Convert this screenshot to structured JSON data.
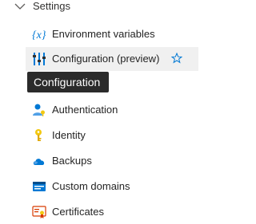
{
  "settings_group": {
    "label": "Settings",
    "items": [
      {
        "label": "Environment variables",
        "icon": "env-variables-icon"
      },
      {
        "label": "Configuration (preview)",
        "icon": "configuration-sliders-icon",
        "selected": true
      },
      {
        "label": "Authentication",
        "icon": "authentication-icon"
      },
      {
        "label": "Identity",
        "icon": "identity-key-icon"
      },
      {
        "label": "Backups",
        "icon": "backups-cloud-icon"
      },
      {
        "label": "Custom domains",
        "icon": "custom-domains-icon"
      },
      {
        "label": "Certificates",
        "icon": "certificates-icon"
      }
    ]
  },
  "tooltip": {
    "text": "Configuration"
  },
  "colors": {
    "accent": "#0078d4",
    "selected_bg": "#f0f0f0",
    "tooltip_bg": "#2b2b2b"
  }
}
